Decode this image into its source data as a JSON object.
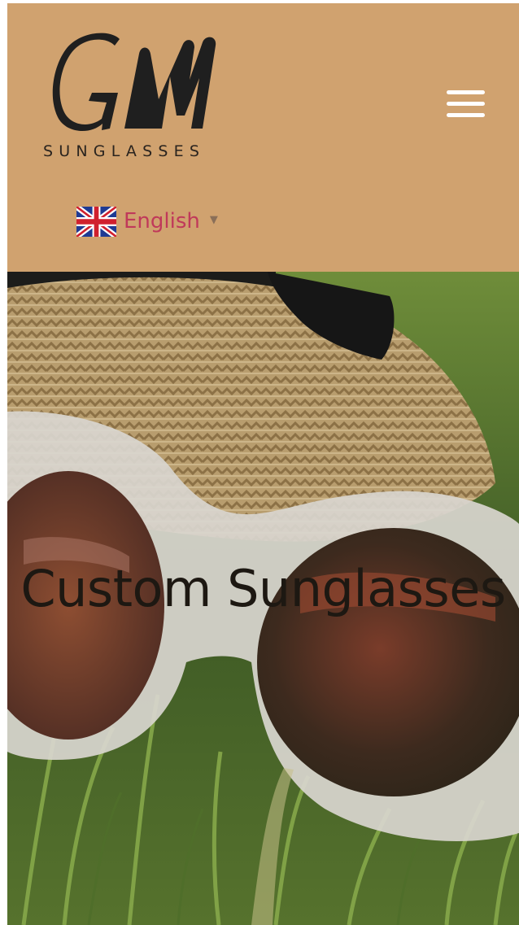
{
  "brand": {
    "logo_text": "GM",
    "tagline": "SUNGLASSES"
  },
  "header": {
    "menu_icon": "hamburger-menu-icon",
    "background": "#d0a26f"
  },
  "language": {
    "flag_icon": "uk-flag-icon",
    "label": "English",
    "caret_icon": "caret-down-icon",
    "label_color": "#c0395a"
  },
  "hero": {
    "title": "Custom Sunglasses"
  }
}
